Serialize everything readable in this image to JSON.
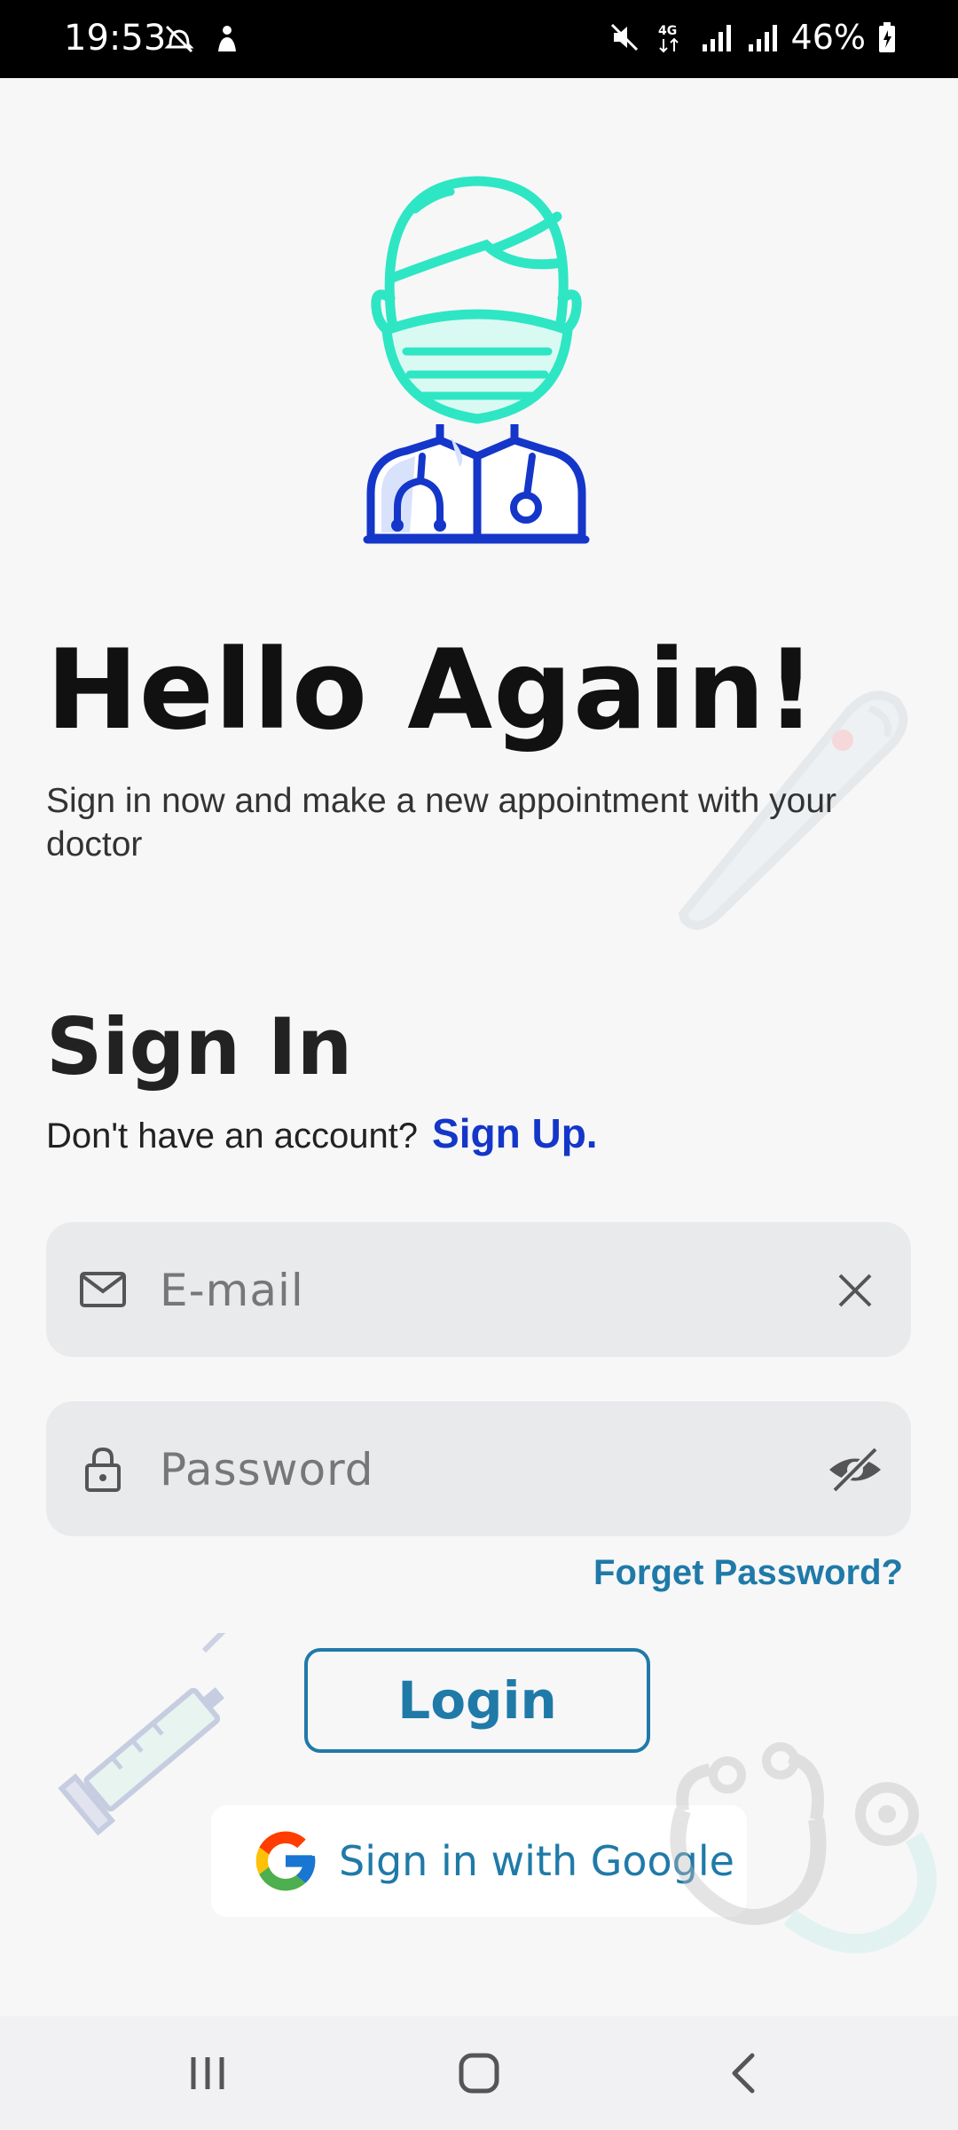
{
  "status_bar": {
    "time": "19:53",
    "battery": "46%",
    "left_icons": [
      "alarm-off-icon",
      "notification-icon"
    ],
    "right_icons": [
      "mute-icon",
      "4g-icon",
      "signal-icon",
      "signal-icon-2",
      "battery-charging-icon"
    ]
  },
  "header": {
    "title": "Hello Again!",
    "subtitle": "Sign in now and make a new appointment with your doctor"
  },
  "signin": {
    "title": "Sign In",
    "no_account_text": "Don't have an account?",
    "signup_link": "Sign Up."
  },
  "form": {
    "email_placeholder": "E-mail",
    "password_placeholder": "Password",
    "forget_password": "Forget Password?",
    "login_label": "Login",
    "google_label": "Sign in with Google"
  },
  "colors": {
    "accent_teal": "#2ee6c4",
    "accent_blue": "#1436c9",
    "link_teal": "#1f7aa8"
  },
  "nav": {
    "buttons": [
      "recent-apps-icon",
      "home-icon",
      "back-icon"
    ]
  }
}
